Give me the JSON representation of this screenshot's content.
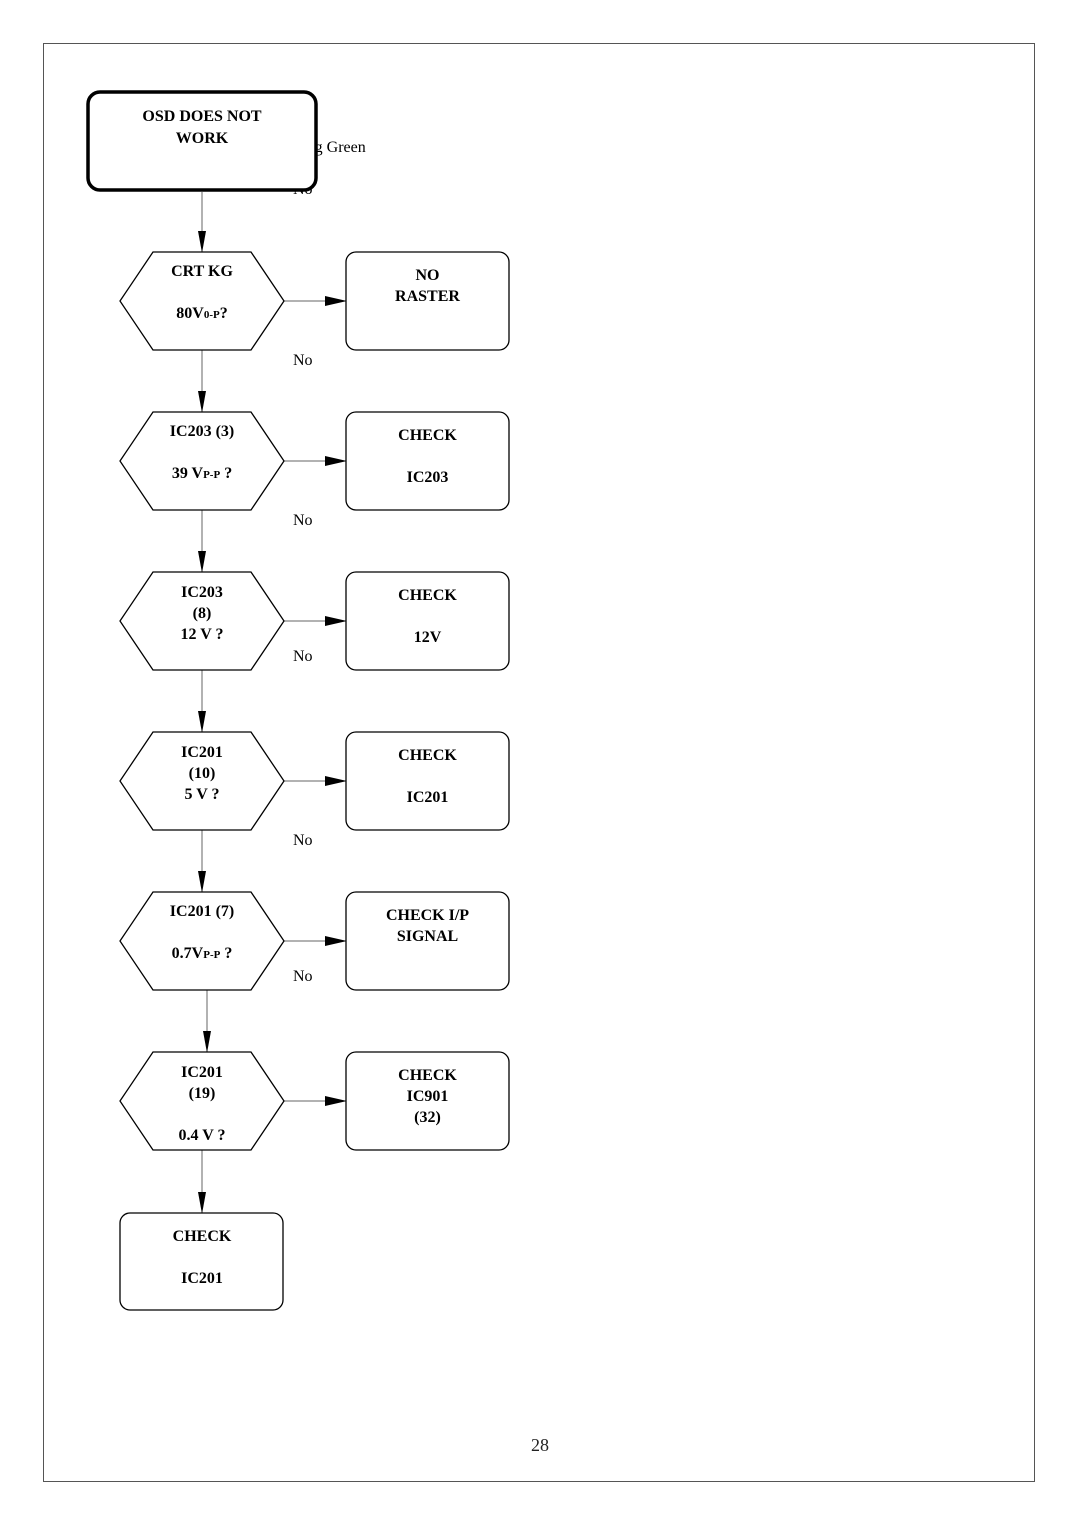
{
  "page": {
    "number": "28",
    "background_fragment": "sing Green",
    "background_no_fragment": "No"
  },
  "flowchart": {
    "start": {
      "lines": [
        "OSD  DOES  NOT",
        "WORK"
      ]
    },
    "decisions": [
      {
        "id": "crt-kg",
        "lines": [
          [
            "CRT  KG"
          ],
          [
            "80V",
            {
              "sub": "0-P"
            },
            "?"
          ]
        ],
        "branch_label": "No",
        "action": {
          "lines": [
            "NO",
            "RASTER"
          ]
        }
      },
      {
        "id": "ic203-3",
        "lines": [
          [
            "IC203 (3)"
          ],
          [
            "39 V",
            {
              "sub": "P-P"
            },
            " ?"
          ]
        ],
        "branch_label": "No",
        "action": {
          "lines": [
            "CHECK",
            "",
            "IC203"
          ]
        }
      },
      {
        "id": "ic203-8",
        "lines": [
          [
            "IC203"
          ],
          [
            "(8)"
          ],
          [
            "12  V ?"
          ]
        ],
        "branch_label": "No",
        "action": {
          "lines": [
            "CHECK",
            "",
            "12V"
          ]
        }
      },
      {
        "id": "ic201-10",
        "lines": [
          [
            "IC201"
          ],
          [
            "(10)"
          ],
          [
            "5 V  ?"
          ]
        ],
        "branch_label": "No",
        "action": {
          "lines": [
            "CHECK",
            "",
            "IC201"
          ]
        }
      },
      {
        "id": "ic201-7",
        "lines": [
          [
            "IC201 (7)"
          ],
          [
            "0.7V",
            {
              "sub": "P-P"
            },
            " ?"
          ]
        ],
        "branch_label": "No",
        "action": {
          "lines": [
            "CHECK  I/P",
            "SIGNAL"
          ]
        }
      },
      {
        "id": "ic201-19",
        "lines": [
          [
            "IC201"
          ],
          [
            "(19)"
          ],
          [
            ""
          ],
          [
            "0.4 V ?"
          ]
        ],
        "branch_label": "",
        "action": {
          "lines": [
            "CHECK",
            "IC901",
            "(32)"
          ]
        }
      }
    ],
    "end": {
      "lines": [
        "CHECK",
        "",
        "IC201"
      ]
    }
  }
}
